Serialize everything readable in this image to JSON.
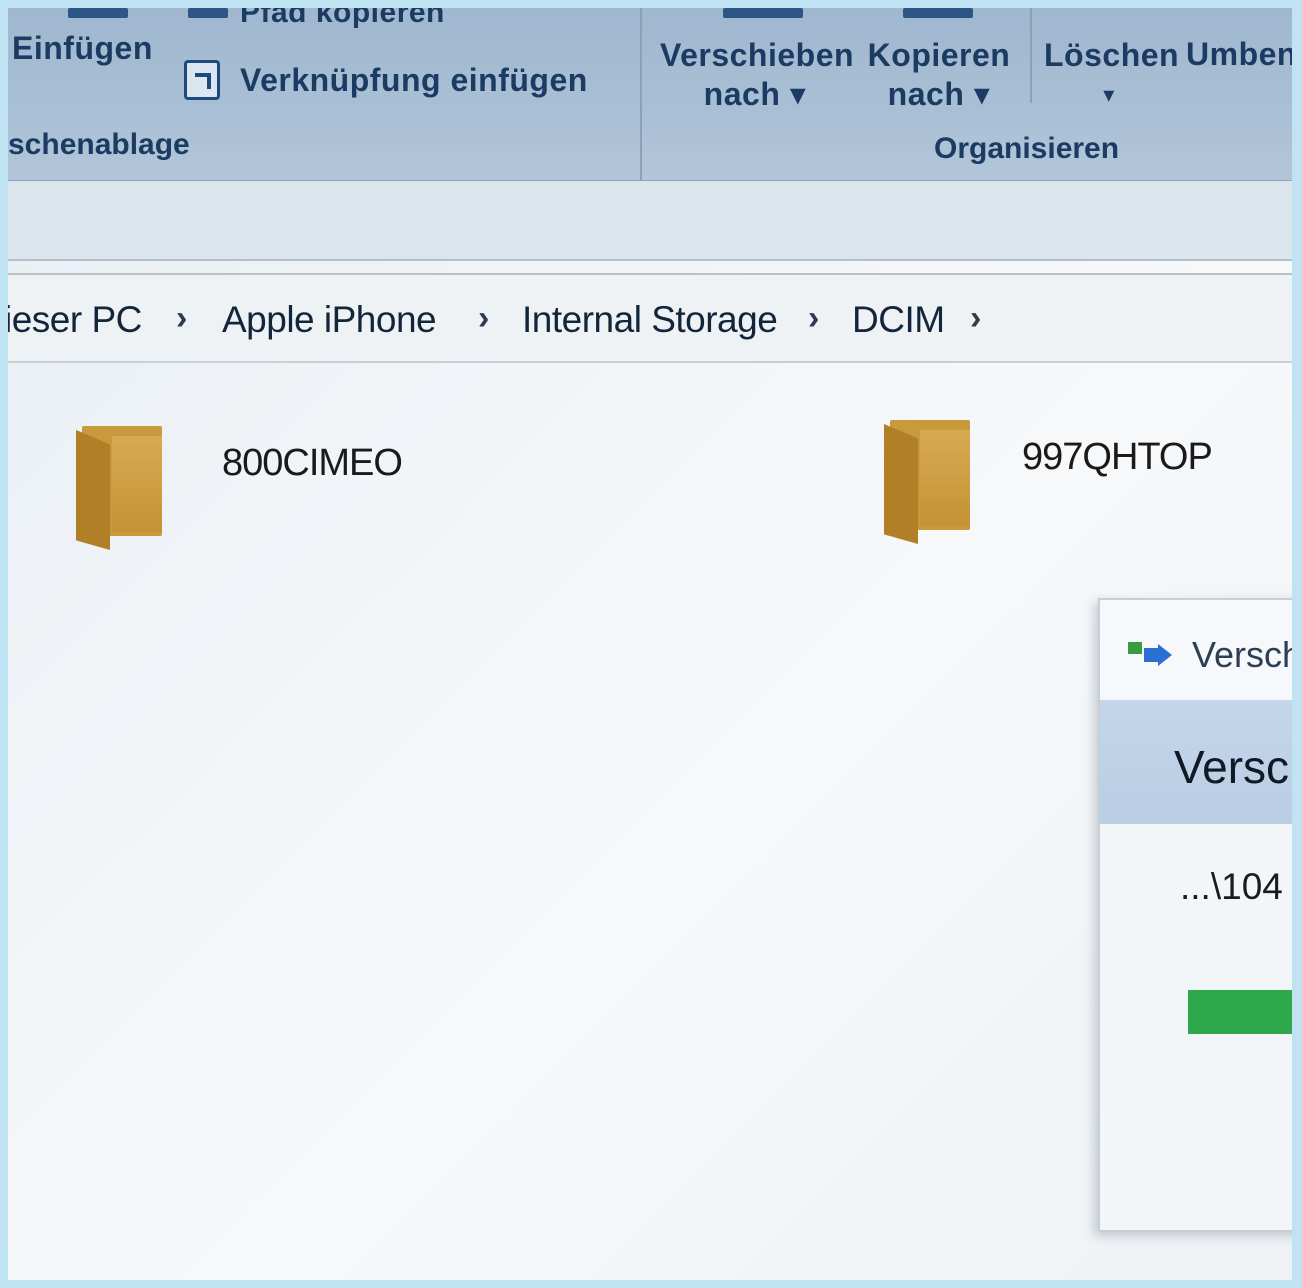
{
  "ribbon": {
    "paste_label": "Einfügen",
    "copy_path_label": "Pfad kopieren",
    "paste_shortcut_label": "Verknüpfung einfügen",
    "clipboard_group_label": "schenablage",
    "move_to_label_line1": "Verschieben",
    "move_to_label_line2": "nach ▾",
    "copy_to_label_line1": "Kopieren",
    "copy_to_label_line2": "nach ▾",
    "delete_label": "Löschen",
    "delete_arrow": "▾",
    "rename_label": "Umben",
    "organize_group_label": "Organisieren"
  },
  "address_bar": {
    "crumbs": [
      "ieser PC",
      "Apple iPhone",
      "Internal Storage",
      "DCIM"
    ],
    "separator": "›"
  },
  "folders": [
    {
      "name": "800CIMEO"
    },
    {
      "name": "997QHTOP"
    }
  ],
  "dialog": {
    "title": "Versch",
    "heading": "Versc",
    "path": "...\\104",
    "progress_percent": 100,
    "colors": {
      "progress": "#2da84a",
      "header": "#c5d6ea"
    }
  }
}
